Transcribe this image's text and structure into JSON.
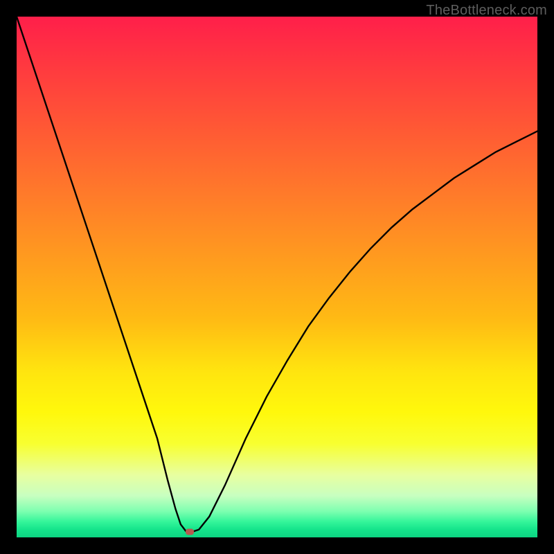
{
  "watermark": "TheBottleneck.com",
  "colors": {
    "page_bg": "#000000",
    "curve_stroke": "#000000",
    "marker_fill": "#b65a4f",
    "watermark_color": "#5e5e5e",
    "gradient_stops": [
      "#ff1f4a",
      "#ff3a3f",
      "#ff5a34",
      "#ff7a2a",
      "#ff9a1f",
      "#ffba14",
      "#ffe40f",
      "#fff80c",
      "#f8ff30",
      "#e8ffa0",
      "#c8ffc0",
      "#7dffb0",
      "#34f59a",
      "#14e48b",
      "#0dd482"
    ]
  },
  "chart_data": {
    "type": "line",
    "title": "",
    "xlabel": "",
    "ylabel": "",
    "xlim": [
      0,
      100
    ],
    "ylim": [
      0,
      100
    ],
    "grid": false,
    "annotations": [
      {
        "label": "marker",
        "x": 33.2,
        "y": 1.1
      }
    ],
    "series": [
      {
        "name": "bottleneck-curve",
        "x": [
          0,
          3,
          6,
          9,
          12,
          15,
          18,
          21,
          24,
          27,
          29,
          30.5,
          31.5,
          32.5,
          33.5,
          35,
          37,
          40,
          44,
          48,
          52,
          56,
          60,
          64,
          68,
          72,
          76,
          80,
          84,
          88,
          92,
          96,
          100
        ],
        "y": [
          100,
          91,
          82,
          73,
          64,
          55,
          46,
          37,
          28,
          19,
          11,
          5.5,
          2.5,
          1.2,
          1.0,
          1.5,
          4,
          10,
          19,
          27,
          34,
          40.5,
          46,
          51,
          55.5,
          59.5,
          63,
          66,
          69,
          71.5,
          74,
          76,
          78
        ]
      }
    ]
  }
}
